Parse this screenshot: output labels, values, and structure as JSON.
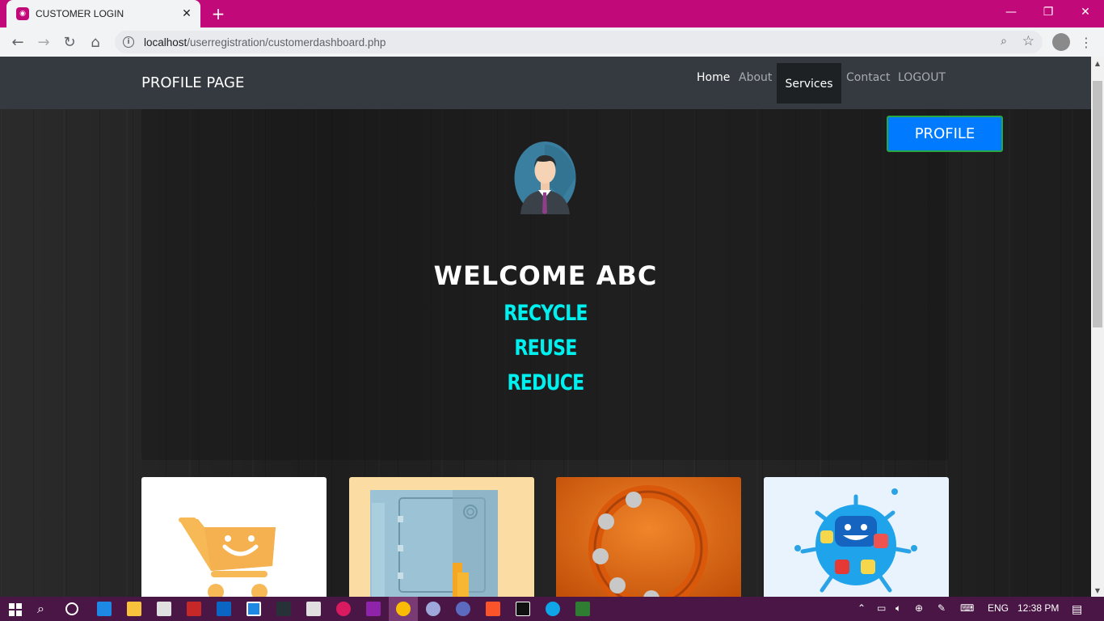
{
  "browser": {
    "tab_title": "CUSTOMER LOGIN",
    "url_host": "localhost",
    "url_path": "/userregistration/customerdashboard.php"
  },
  "navbar": {
    "brand": "PROFILE PAGE",
    "links": [
      "Home",
      "About",
      "Services",
      "Contact",
      "LOGOUT"
    ]
  },
  "hero": {
    "profile_button": "PROFILE",
    "welcome": "WELCOME ABC",
    "slogans": [
      "RECYCLE",
      "REUSE",
      "REDUCE"
    ]
  },
  "taskbar": {
    "language": "ENG",
    "time": "12:38 PM"
  },
  "colors": {
    "browser_accent": "#c2097a",
    "navbar": "#343a40",
    "slogan": "#00f0f0",
    "profile_button": "#007bff",
    "taskbar": "#4a1645"
  }
}
